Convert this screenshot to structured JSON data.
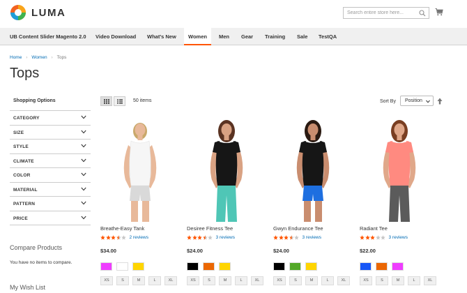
{
  "brand": {
    "name": "LUMA"
  },
  "search": {
    "placeholder": "Search entire store here..."
  },
  "nav": [
    "UB Content Slider Magento 2.0",
    "Video Download",
    "What's New",
    "Women",
    "Men",
    "Gear",
    "Training",
    "Sale",
    "TestQA"
  ],
  "nav_active": "Women",
  "breadcrumb": [
    "Home",
    "Women",
    "Tops"
  ],
  "page_title": "Tops",
  "sidebar": {
    "shopping_options": "Shopping Options",
    "filters": [
      "CATEGORY",
      "SIZE",
      "STYLE",
      "CLIMATE",
      "COLOR",
      "MATERIAL",
      "PATTERN",
      "PRICE"
    ],
    "compare_title": "Compare Products",
    "compare_text": "You have no items to compare.",
    "wishlist_title": "My Wish List"
  },
  "toolbar": {
    "items_count": "50 items",
    "sort_label": "Sort By",
    "sort_value": "Position"
  },
  "colors": {
    "accent": "#ff5501",
    "link": "#006bb4",
    "star": "#ff5501"
  },
  "products": [
    {
      "name": "Breathe-Easy Tank",
      "rating": 3.5,
      "reviews": "2 reviews",
      "price": "$34.00",
      "swatches": [
        "#ef3dff",
        "#ffffff",
        "#ffd500"
      ],
      "sizes": [
        "XS",
        "S",
        "M",
        "L",
        "XL"
      ],
      "model": {
        "top": "#f6f6f6",
        "bottom": "#d9d9d9",
        "skin": "#e8b99a",
        "hair": "#c9a86a"
      }
    },
    {
      "name": "Desiree Fitness Tee",
      "rating": 3.5,
      "reviews": "3 reviews",
      "price": "$24.00",
      "swatches": [
        "#000000",
        "#eb6703",
        "#ffd500"
      ],
      "sizes": [
        "XS",
        "S",
        "M",
        "L",
        "XL"
      ],
      "model": {
        "top": "#161616",
        "bottom": "#4fc6b6",
        "skin": "#d9a283",
        "hair": "#5a3322"
      }
    },
    {
      "name": "Gwyn Endurance Tee",
      "rating": 3.5,
      "reviews": "3 reviews",
      "price": "$24.00",
      "swatches": [
        "#000000",
        "#53a828",
        "#ffd500"
      ],
      "sizes": [
        "XS",
        "S",
        "M",
        "L",
        "XL"
      ],
      "model": {
        "top": "#161616",
        "bottom": "#1e6fe0",
        "skin": "#c98d6f",
        "hair": "#2a1a12"
      }
    },
    {
      "name": "Radiant Tee",
      "rating": 3,
      "reviews": "3 reviews",
      "price": "$22.00",
      "swatches": [
        "#1857f7",
        "#eb6703",
        "#ef3dff"
      ],
      "sizes": [
        "XS",
        "S",
        "M",
        "L",
        "XL"
      ],
      "model": {
        "top": "#ff8a80",
        "bottom": "#5b5b5b",
        "skin": "#e0a88a",
        "hair": "#7a3f22"
      }
    }
  ]
}
